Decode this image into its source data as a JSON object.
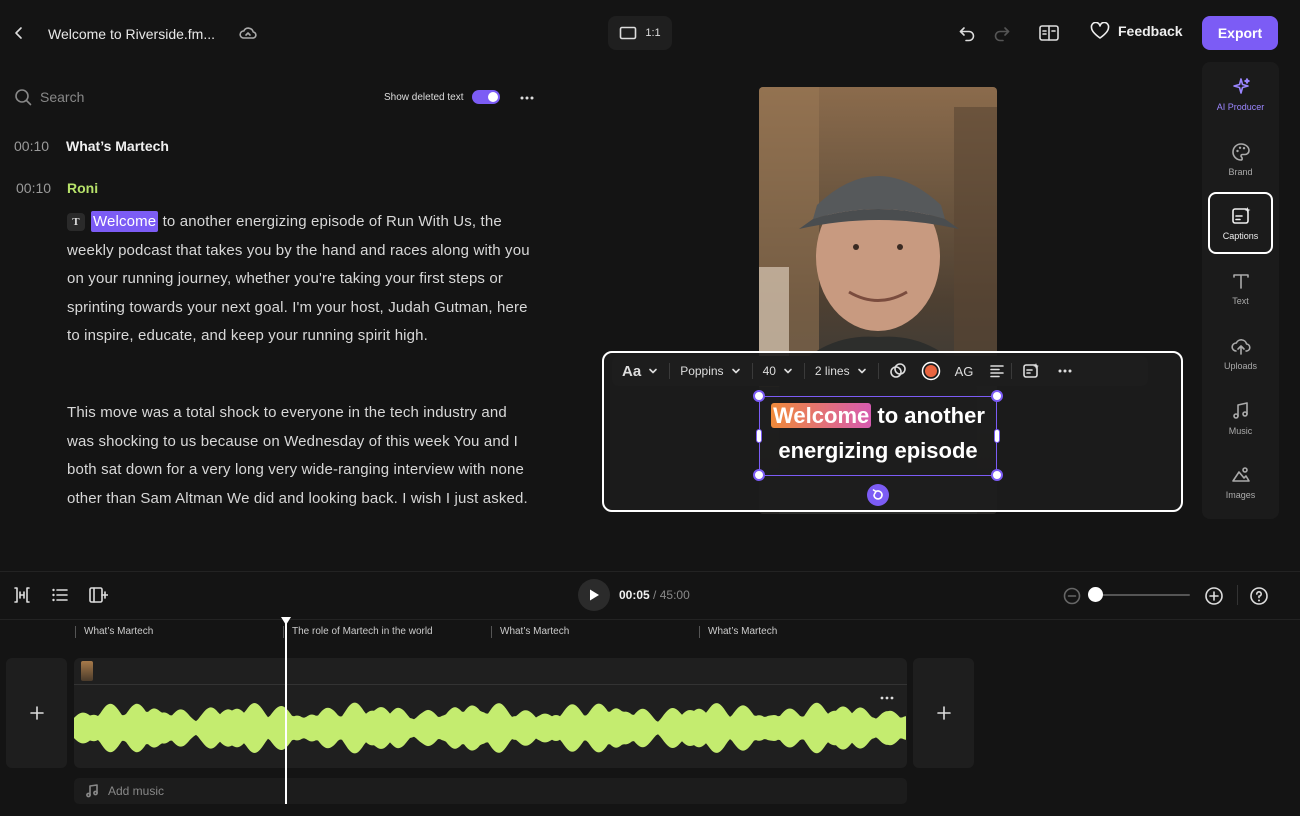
{
  "header": {
    "back_icon": "chevron-left-icon",
    "project_title": "Welcome to Riverside.fm...",
    "aspect_ratio": "1:1",
    "feedback_label": "Feedback",
    "export_label": "Export"
  },
  "transcript": {
    "search_placeholder": "Search",
    "show_deleted_label": "Show deleted text",
    "show_deleted_on": true,
    "section": {
      "time": "00:10",
      "title": "What’s Martech"
    },
    "speaker": {
      "time": "00:10",
      "name": "Roni"
    },
    "badge": "T",
    "highlight_word": "Welcome",
    "para1_rest": " to another energizing episode of Run With Us, the weekly podcast that takes you by the hand and races along with you on your running journey, whether you're taking your first steps or sprinting towards your next goal. I'm your host, Judah Gutman, here to inspire, educate, and keep your running spirit high.",
    "para2": "This move was a total shock to everyone in the tech industry and was shocking to us because on Wednesday of this week You and I both sat down for a very long very wide-ranging interview with none other than Sam Altman We did and looking back. I wish I just asked."
  },
  "caption_toolbar": {
    "style_label": "Aa",
    "font": "Poppins",
    "size": "40",
    "lines": "2 lines",
    "case_label": "AG"
  },
  "caption": {
    "highlight": "Welcome",
    "line1_rest": " to another",
    "line2": "energizing episode"
  },
  "rail": {
    "items": [
      {
        "label": "AI Producer",
        "icon": "sparkle-icon"
      },
      {
        "label": "Brand",
        "icon": "palette-icon"
      },
      {
        "label": "Captions",
        "icon": "captions-icon"
      },
      {
        "label": "Text",
        "icon": "text-icon"
      },
      {
        "label": "Uploads",
        "icon": "upload-cloud-icon"
      },
      {
        "label": "Music",
        "icon": "music-icon"
      },
      {
        "label": "Images",
        "icon": "image-icon"
      }
    ],
    "active": "Captions"
  },
  "timeline": {
    "current_time": "00:05",
    "duration": "/ 45:00",
    "zoom_level": 0.05,
    "markers": [
      "What’s Martech",
      "The role of Martech in the world",
      "What’s Martech",
      "What’s Martech"
    ],
    "add_music_label": "Add music"
  },
  "colors": {
    "accent": "#7c5cf5",
    "speaker": "#b7e26a",
    "waveform": "#c4ec6f"
  }
}
